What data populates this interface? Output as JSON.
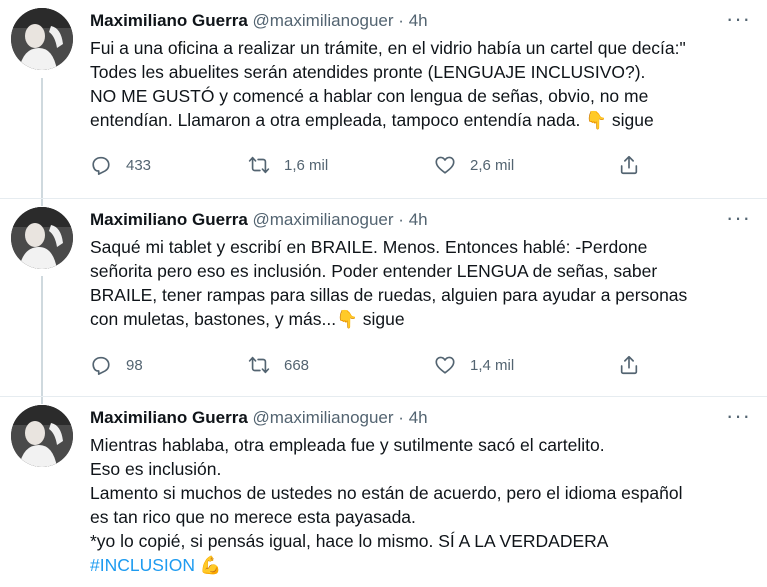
{
  "tweets": [
    {
      "author_name": "Maximiliano Guerra",
      "handle": "@maximilianoguer",
      "time": "4h",
      "lines": [
        "Fui a una oficina a realizar un trámite, en el vidrio había un cartel que decía:\"",
        "Todes les abuelites serán atendides pronte (LENGUAJE INCLUSIVO?).",
        "NO ME GUSTÓ y comencé a hablar con lengua de señas, obvio, no me",
        "entendían. Llamaron a otra empleada, tampoco entendía nada."
      ],
      "emoji": "👇",
      "trailing": "sigue",
      "replies": "433",
      "retweets": "1,6 mil",
      "likes": "2,6 mil"
    },
    {
      "author_name": "Maximiliano Guerra",
      "handle": "@maximilianoguer",
      "time": "4h",
      "lines": [
        "Saqué mi tablet y escribí en BRAILE. Menos. Entonces hablé: -Perdone",
        "señorita pero eso es inclusión. Poder entender LENGUA de señas, saber",
        "BRAILE, tener rampas para sillas de ruedas, alguien para ayudar a personas",
        "con muletas, bastones, y más..."
      ],
      "emoji": "👇",
      "trailing": "sigue",
      "replies": "98",
      "retweets": "668",
      "likes": "1,4 mil"
    },
    {
      "author_name": "Maximiliano Guerra",
      "handle": "@maximilianoguer",
      "time": "4h",
      "lines": [
        "Mientras hablaba, otra empleada fue y sutilmente sacó el cartelito.",
        "Eso es inclusión.",
        "Lamento si muchos de ustedes no están de acuerdo, pero el idioma español",
        "es tan rico que no merece esta payasada.",
        "*yo lo copié, si pensás igual, hace lo mismo. SÍ A LA VERDADERA"
      ],
      "hashtag": "#INCLUSION",
      "emoji": "💪"
    }
  ],
  "separator": "·",
  "more_glyph": "···",
  "colors": {
    "text": "#0f1419",
    "secondary": "#536471",
    "link": "#1d9bf0",
    "thread_line": "#cfd9de"
  },
  "icons": {
    "reply": "reply-icon",
    "retweet": "retweet-icon",
    "like": "heart-icon",
    "share": "share-icon",
    "more": "more-icon"
  }
}
